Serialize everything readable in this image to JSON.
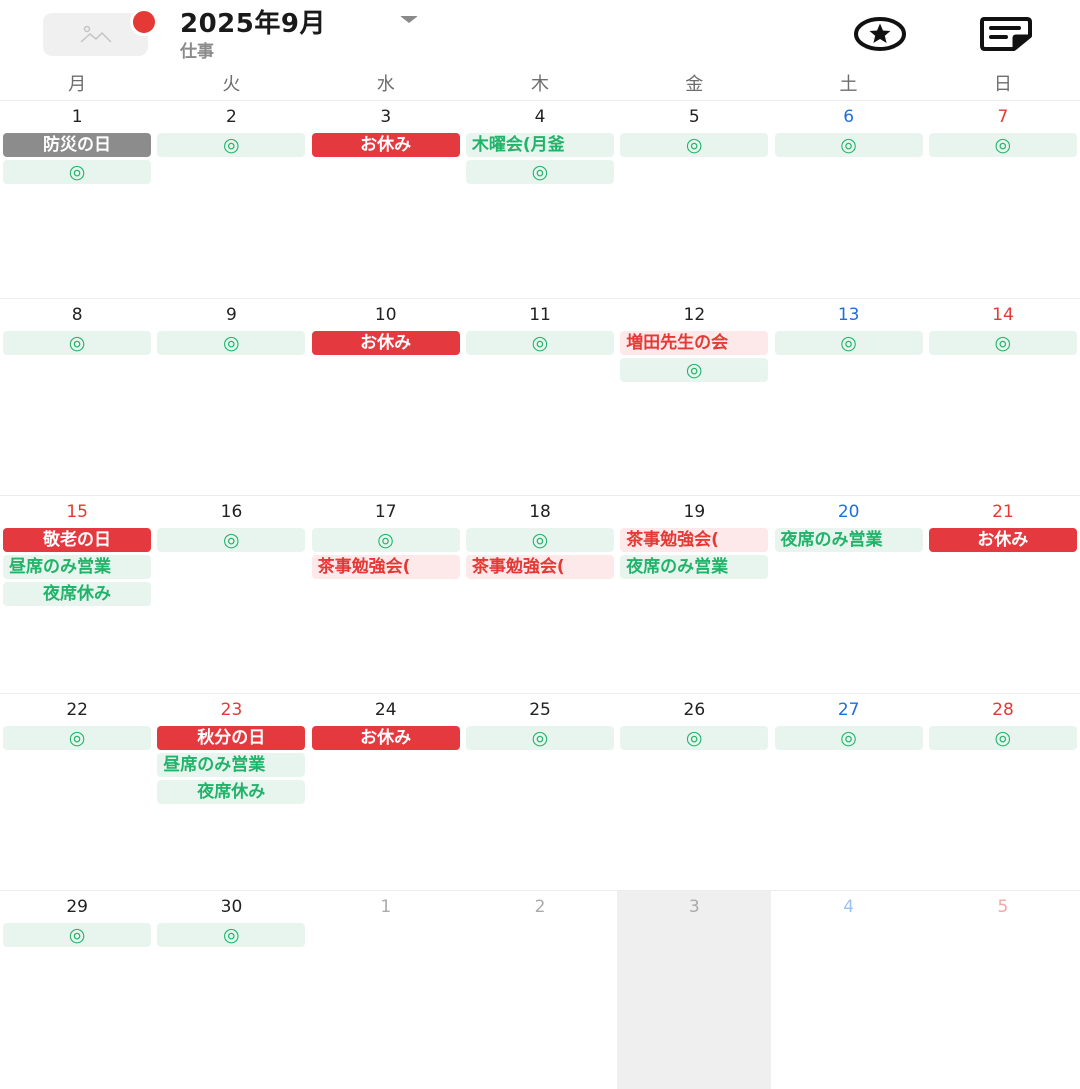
{
  "header": {
    "title": "2025年9月",
    "subtitle": "仕事",
    "colors": {
      "accent_red": "#e53935",
      "green": "#22b36a"
    }
  },
  "weekdays": [
    "月",
    "火",
    "水",
    "木",
    "金",
    "土",
    "日"
  ],
  "weeks": [
    [
      {
        "day": "1",
        "events": [
          {
            "text": "防災の日",
            "style": "gray"
          },
          {
            "text": "◎",
            "style": "green"
          }
        ]
      },
      {
        "day": "2",
        "events": [
          {
            "text": "◎",
            "style": "green"
          }
        ]
      },
      {
        "day": "3",
        "events": [
          {
            "text": "お休み",
            "style": "red"
          }
        ]
      },
      {
        "day": "4",
        "events": [
          {
            "text": "木曜会(月釜",
            "style": "green"
          },
          {
            "text": "◎",
            "style": "green"
          }
        ]
      },
      {
        "day": "5",
        "events": [
          {
            "text": "◎",
            "style": "green"
          }
        ]
      },
      {
        "day": "6",
        "kind": "sat",
        "events": [
          {
            "text": "◎",
            "style": "green"
          }
        ]
      },
      {
        "day": "7",
        "kind": "sun",
        "events": [
          {
            "text": "◎",
            "style": "green"
          }
        ]
      }
    ],
    [
      {
        "day": "8",
        "events": [
          {
            "text": "◎",
            "style": "green"
          }
        ]
      },
      {
        "day": "9",
        "events": [
          {
            "text": "◎",
            "style": "green"
          }
        ]
      },
      {
        "day": "10",
        "events": [
          {
            "text": "お休み",
            "style": "red"
          }
        ]
      },
      {
        "day": "11",
        "events": [
          {
            "text": "◎",
            "style": "green"
          }
        ]
      },
      {
        "day": "12",
        "events": [
          {
            "text": "増田先生の会",
            "style": "pink"
          },
          {
            "text": "◎",
            "style": "green"
          }
        ]
      },
      {
        "day": "13",
        "kind": "sat",
        "events": [
          {
            "text": "◎",
            "style": "green"
          }
        ]
      },
      {
        "day": "14",
        "kind": "sun",
        "events": [
          {
            "text": "◎",
            "style": "green"
          }
        ]
      }
    ],
    [
      {
        "day": "15",
        "kind": "sun",
        "events": [
          {
            "text": "敬老の日",
            "style": "red"
          },
          {
            "text": "昼席のみ営業",
            "style": "green"
          },
          {
            "text": "夜席休み",
            "style": "green"
          }
        ]
      },
      {
        "day": "16",
        "events": [
          {
            "text": "◎",
            "style": "green"
          }
        ]
      },
      {
        "day": "17",
        "events": [
          {
            "text": "◎",
            "style": "green"
          },
          {
            "text": "茶事勉強会(",
            "style": "pink"
          }
        ]
      },
      {
        "day": "18",
        "events": [
          {
            "text": "◎",
            "style": "green"
          },
          {
            "text": "茶事勉強会(",
            "style": "pink"
          }
        ]
      },
      {
        "day": "19",
        "events": [
          {
            "text": "茶事勉強会(",
            "style": "pink"
          },
          {
            "text": "夜席のみ営業",
            "style": "green"
          }
        ]
      },
      {
        "day": "20",
        "kind": "sat",
        "events": [
          {
            "text": "夜席のみ営業",
            "style": "green"
          }
        ]
      },
      {
        "day": "21",
        "kind": "sun",
        "events": [
          {
            "text": "お休み",
            "style": "red"
          }
        ]
      }
    ],
    [
      {
        "day": "22",
        "events": [
          {
            "text": "◎",
            "style": "green"
          }
        ]
      },
      {
        "day": "23",
        "kind": "sun",
        "events": [
          {
            "text": "秋分の日",
            "style": "red"
          },
          {
            "text": "昼席のみ営業",
            "style": "green"
          },
          {
            "text": "夜席休み",
            "style": "green"
          }
        ]
      },
      {
        "day": "24",
        "events": [
          {
            "text": "お休み",
            "style": "red"
          }
        ]
      },
      {
        "day": "25",
        "events": [
          {
            "text": "◎",
            "style": "green"
          }
        ]
      },
      {
        "day": "26",
        "events": [
          {
            "text": "◎",
            "style": "green"
          }
        ]
      },
      {
        "day": "27",
        "kind": "sat",
        "events": [
          {
            "text": "◎",
            "style": "green"
          }
        ]
      },
      {
        "day": "28",
        "kind": "sun",
        "events": [
          {
            "text": "◎",
            "style": "green"
          }
        ]
      }
    ],
    [
      {
        "day": "29",
        "events": [
          {
            "text": "◎",
            "style": "green"
          }
        ]
      },
      {
        "day": "30",
        "events": [
          {
            "text": "◎",
            "style": "green"
          }
        ]
      },
      {
        "day": "1",
        "kind": "other",
        "events": []
      },
      {
        "day": "2",
        "kind": "other",
        "events": []
      },
      {
        "day": "3",
        "kind": "other",
        "today": true,
        "events": []
      },
      {
        "day": "4",
        "kind": "other sat",
        "events": []
      },
      {
        "day": "5",
        "kind": "other sun",
        "events": []
      }
    ]
  ]
}
